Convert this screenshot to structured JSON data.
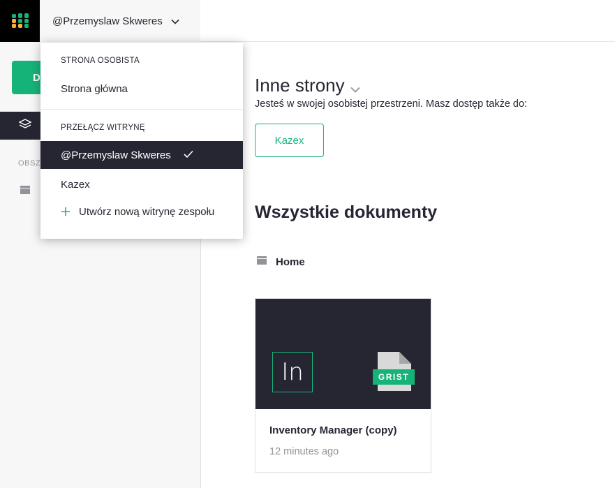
{
  "header": {
    "org_name": "@Przemyslaw Skweres"
  },
  "sidebar": {
    "add_new_label": "D",
    "workspaces_label": "OBSZ"
  },
  "main": {
    "other_sites_title": "Inne strony",
    "other_sites_desc": "Jesteś w swojej osobistej przestrzeni. Masz dostęp także do:",
    "site_button": "Kazex",
    "all_docs_title": "Wszystkie dokumenty",
    "workspace_name": "Home",
    "doc": {
      "initials": "In",
      "file_badge": "GRIST",
      "name": "Inventory Manager (copy)",
      "updated": "12 minutes ago"
    }
  },
  "menu": {
    "personal_header": "STRONA OSOBISTA",
    "home_item": "Strona główna",
    "switch_header": "PRZEŁĄCZ WITRYNĘ",
    "sites": [
      {
        "label": "@Przemyslaw Skweres",
        "selected": true
      },
      {
        "label": "Kazex",
        "selected": false
      }
    ],
    "create_team_site": "Utwórz nową witrynę zespołu"
  },
  "colors": {
    "accent": "#16b378",
    "dark": "#262633",
    "muted": "#929299"
  }
}
